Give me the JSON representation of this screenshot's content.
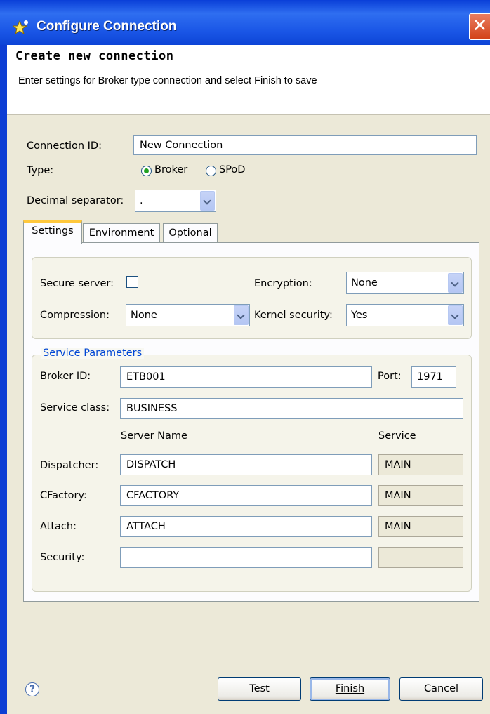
{
  "window": {
    "title": "Configure Connection",
    "close_glyph": "✕"
  },
  "banner": {
    "title": "Create new connection",
    "description": "Enter settings for Broker type connection and select Finish to save"
  },
  "form": {
    "connection_id_label": "Connection ID:",
    "connection_id_value": "New Connection",
    "type_label": "Type:",
    "type_options": [
      "Broker",
      "SPoD"
    ],
    "type_selected": "Broker",
    "decimal_label": "Decimal separator:",
    "decimal_value": "."
  },
  "tabs": [
    {
      "label": "Settings",
      "active": true
    },
    {
      "label": "Environment",
      "active": false
    },
    {
      "label": "Optional",
      "active": false
    }
  ],
  "settings": {
    "secure_server_label": "Secure server:",
    "secure_server_checked": false,
    "encryption_label": "Encryption:",
    "encryption_value": "None",
    "compression_label": "Compression:",
    "compression_value": "None",
    "kernel_security_label": "Kernel security:",
    "kernel_security_value": "Yes"
  },
  "service_params": {
    "legend": "Service Parameters",
    "broker_id_label": "Broker ID:",
    "broker_id_value": "ETB001",
    "port_label": "Port:",
    "port_value": "1971",
    "service_class_label": "Service class:",
    "service_class_value": "BUSINESS",
    "server_name_header": "Server Name",
    "service_header": "Service",
    "rows": [
      {
        "label": "Dispatcher:",
        "server": "DISPATCH",
        "service": "MAIN"
      },
      {
        "label": "CFactory:",
        "server": "CFACTORY",
        "service": "MAIN"
      },
      {
        "label": "Attach:",
        "server": "ATTACH",
        "service": "MAIN"
      },
      {
        "label": "Security:",
        "server": "",
        "service": ""
      }
    ]
  },
  "footer": {
    "help_glyph": "?",
    "test_label": "Test",
    "finish_label": "Finish",
    "cancel_label": "Cancel"
  },
  "colors": {
    "titlebar": "#0a3fd8",
    "dialog_bg": "#ece9d8",
    "tab_accent": "#ffc83c",
    "legend_text": "#0046d5",
    "radio_dot": "#21a121"
  }
}
